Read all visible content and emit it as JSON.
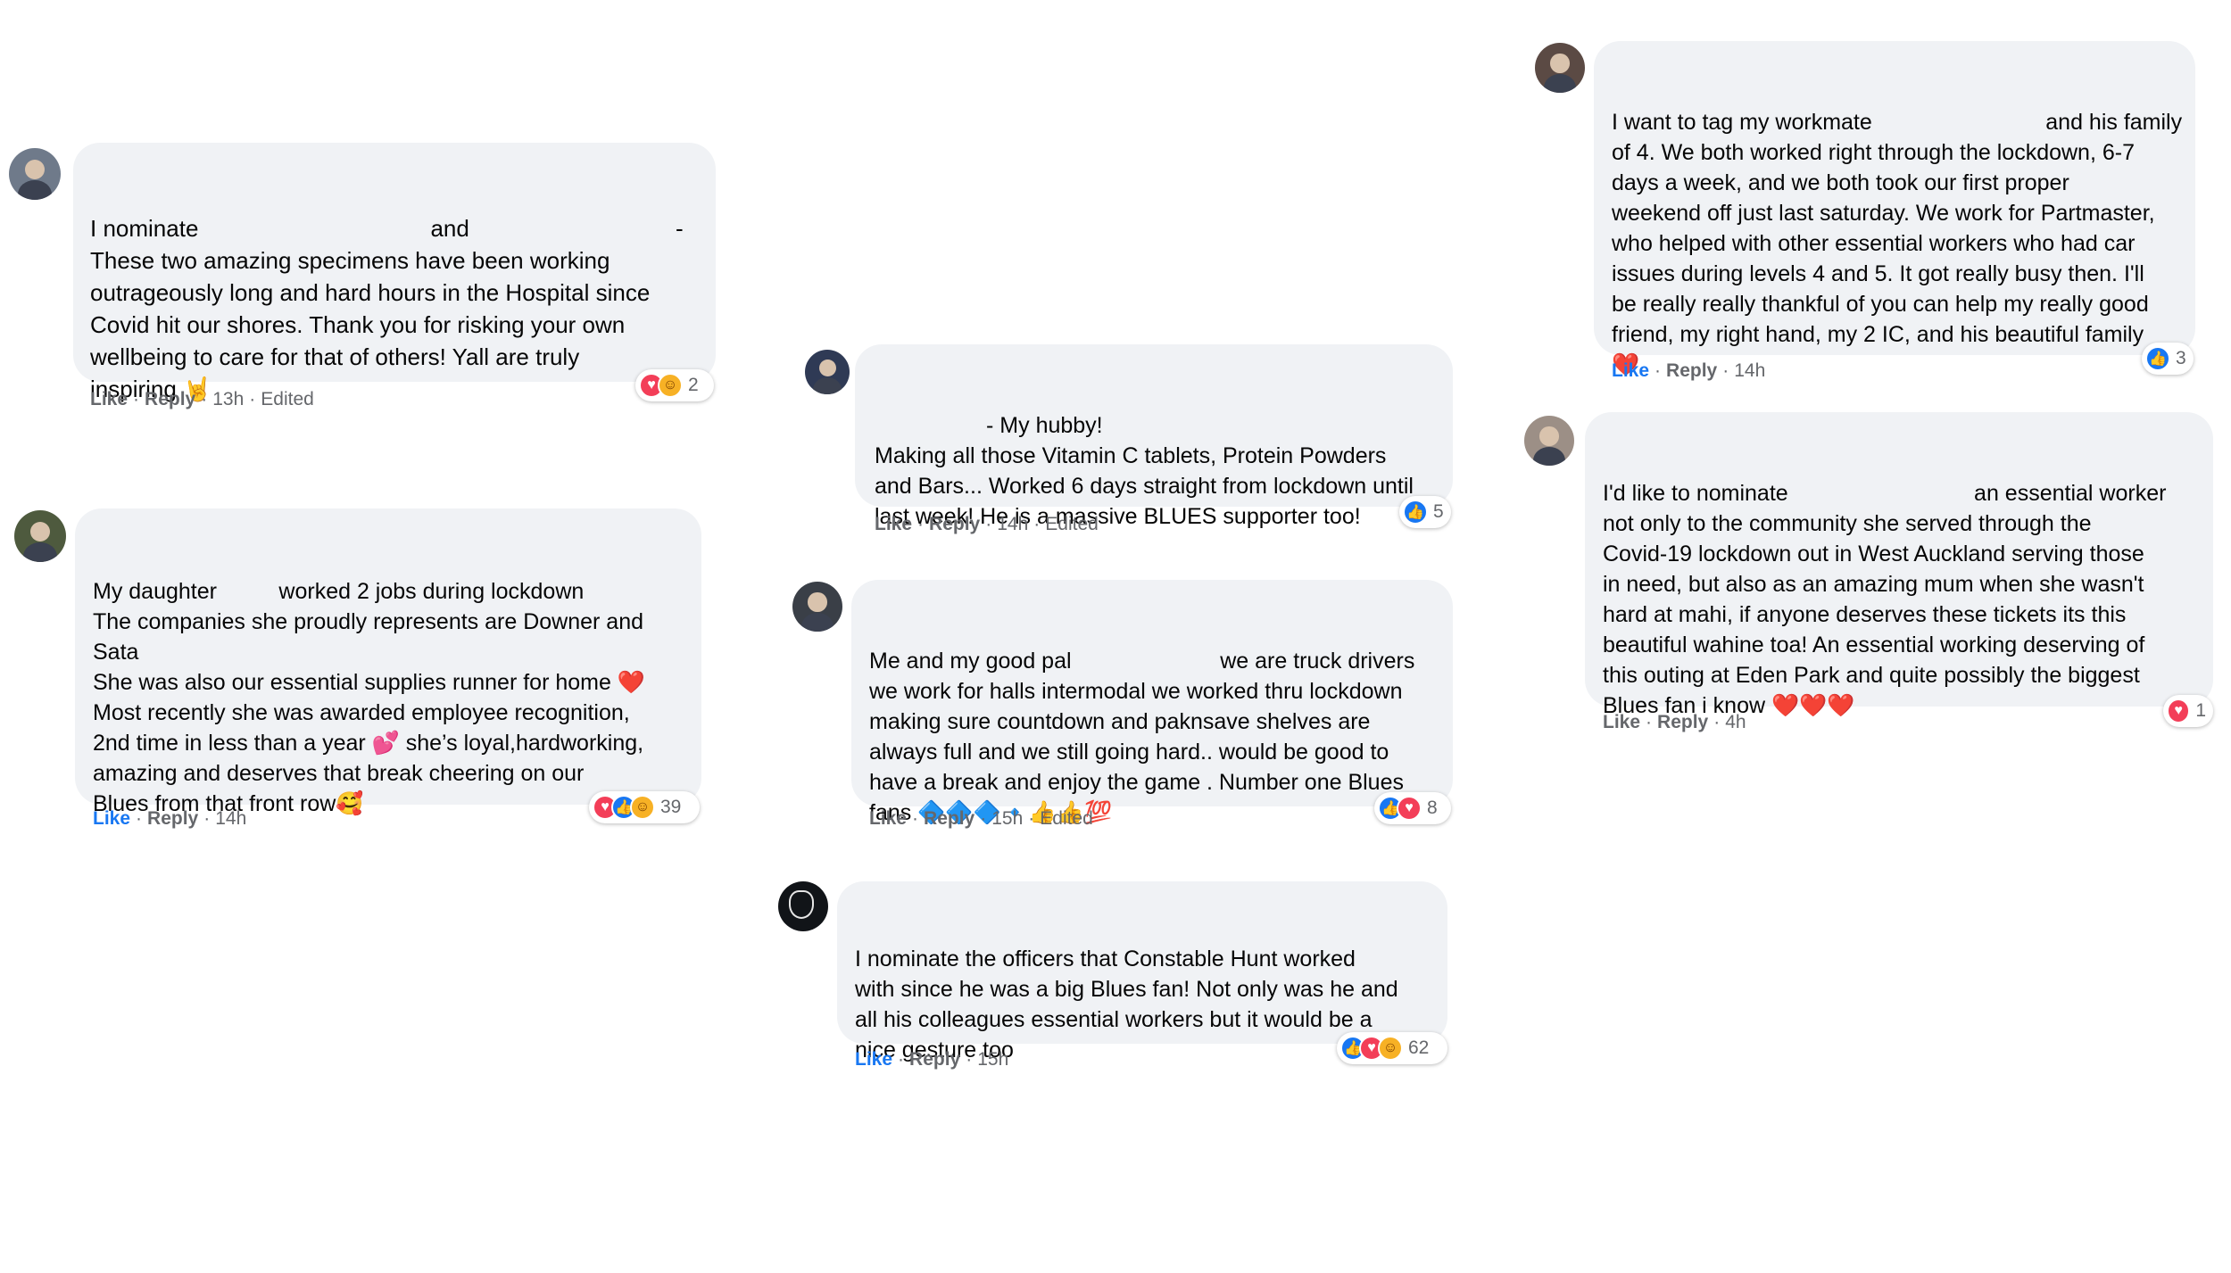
{
  "comments": [
    {
      "id": "c1",
      "lines": [
        "I nominate                                    and                                -",
        "These two amazing specimens have been working",
        "outrageously long and hard hours in the Hospital since",
        "Covid hit our shores. Thank you for risking your own",
        "wellbeing to care for that of others! Yall are truly",
        "inspiring 🤘"
      ],
      "like_label": "Like",
      "reply_label": "Reply",
      "time": "13h",
      "edited": "Edited",
      "liked": false,
      "reactions": [
        "love",
        "care"
      ],
      "reaction_count": "2"
    },
    {
      "id": "c2",
      "lines": [
        "My daughter          worked 2 jobs during lockdown",
        "The companies she proudly represents are Downer and",
        "Sata",
        "She was also our essential supplies runner for home ❤️",
        "Most recently she was awarded employee recognition,",
        "2nd time in less than a year 💕 she’s loyal,hardworking,",
        "amazing and deserves that break cheering on our",
        "Blues from that front row🥰"
      ],
      "like_label": "Like",
      "reply_label": "Reply",
      "time": "14h",
      "edited": "",
      "liked": true,
      "reactions": [
        "love",
        "like",
        "care"
      ],
      "reaction_count": "39"
    },
    {
      "id": "c3",
      "lines": [
        "                  - My hubby!",
        "Making all those Vitamin C tablets, Protein Powders",
        "and Bars... Worked 6 days straight from lockdown until",
        "last week! He is a massive BLUES supporter too!"
      ],
      "like_label": "Like",
      "reply_label": "Reply",
      "time": "14h",
      "edited": "Edited",
      "liked": false,
      "reactions": [
        "like"
      ],
      "reaction_count": "5"
    },
    {
      "id": "c4",
      "lines": [
        "Me and my good pal                        we are truck drivers",
        "we work for halls intermodal we worked thru lockdown",
        "making sure countdown and paknsave shelves are",
        "always full and we still going hard.. would be good to",
        "have a break and enjoy the game . Number one Blues",
        "fans 🔷🔷🔷🔹👍👍💯"
      ],
      "like_label": "Like",
      "reply_label": "Reply",
      "time": "15h",
      "edited": "Edited",
      "liked": false,
      "reactions": [
        "like",
        "love"
      ],
      "reaction_count": "8"
    },
    {
      "id": "c5",
      "lines": [
        "I nominate the officers that Constable Hunt worked",
        "with since he was a big Blues fan! Not only was he and",
        "all his colleagues essential workers but it would be a",
        "nice gesture too"
      ],
      "like_label": "Like",
      "reply_label": "Reply",
      "time": "15h",
      "edited": "",
      "liked": true,
      "reactions": [
        "like",
        "love",
        "care"
      ],
      "reaction_count": "62"
    },
    {
      "id": "c6",
      "lines": [
        "I want to tag my workmate                            and his family",
        "of 4. We both worked right through the lockdown, 6-7",
        "days a week, and we both took our first proper",
        "weekend off just last saturday. We work for Partmaster,",
        "who helped with other essential workers who had car",
        "issues during levels 4 and 5. It got really busy then. I'll",
        "be really really thankful of you can help my really good",
        "friend, my right hand, my 2 IC, and his beautiful family",
        "❤️"
      ],
      "like_label": "Like",
      "reply_label": "Reply",
      "time": "14h",
      "edited": "",
      "liked": true,
      "reactions": [
        "like"
      ],
      "reaction_count": "3"
    },
    {
      "id": "c7",
      "lines": [
        "I'd like to nominate                              an essential worker",
        "not only to the community she served through the",
        "Covid-19 lockdown out in West Auckland serving those",
        "in need, but also as an amazing mum when she wasn't",
        "hard at mahi, if anyone deserves these tickets its this",
        "beautiful wahine toa! An essential working deserving of",
        "this outing at Eden Park and quite possibly the biggest",
        "Blues fan i know ❤️❤️❤️"
      ],
      "like_label": "Like",
      "reply_label": "Reply",
      "time": "4h",
      "edited": "",
      "liked": false,
      "reactions": [
        "love"
      ],
      "reaction_count": "1"
    }
  ]
}
